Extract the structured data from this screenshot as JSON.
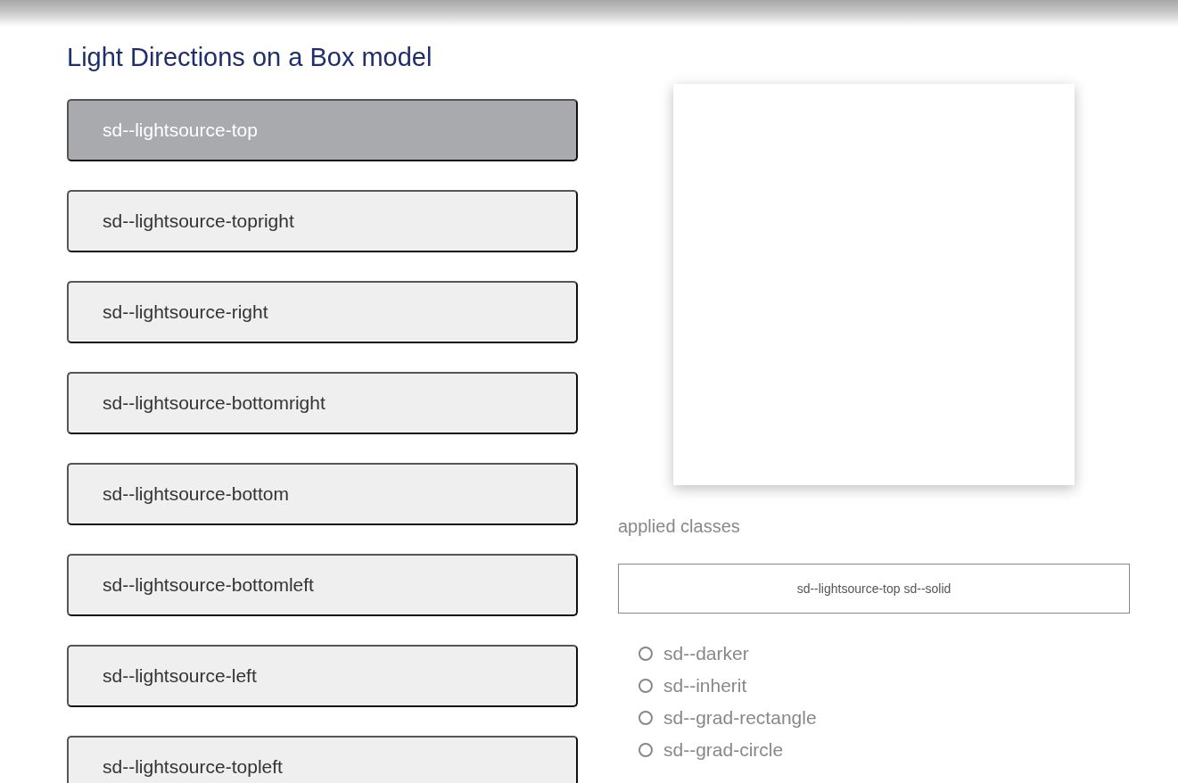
{
  "title": "Light Directions on a Box model",
  "options": [
    {
      "label": "sd--lightsource-top",
      "selected": true
    },
    {
      "label": "sd--lightsource-topright",
      "selected": false
    },
    {
      "label": "sd--lightsource-right",
      "selected": false
    },
    {
      "label": "sd--lightsource-bottomright",
      "selected": false
    },
    {
      "label": "sd--lightsource-bottom",
      "selected": false
    },
    {
      "label": "sd--lightsource-bottomleft",
      "selected": false
    },
    {
      "label": "sd--lightsource-left",
      "selected": false
    },
    {
      "label": "sd--lightsource-topleft",
      "selected": false
    }
  ],
  "applied_label": "applied classes",
  "applied_value": "sd--lightsource-top sd--solid",
  "modifiers": [
    {
      "label": "sd--darker",
      "checked": false
    },
    {
      "label": "sd--inherit",
      "checked": false
    },
    {
      "label": "sd--grad-rectangle",
      "checked": false
    },
    {
      "label": "sd--grad-circle",
      "checked": false
    }
  ]
}
